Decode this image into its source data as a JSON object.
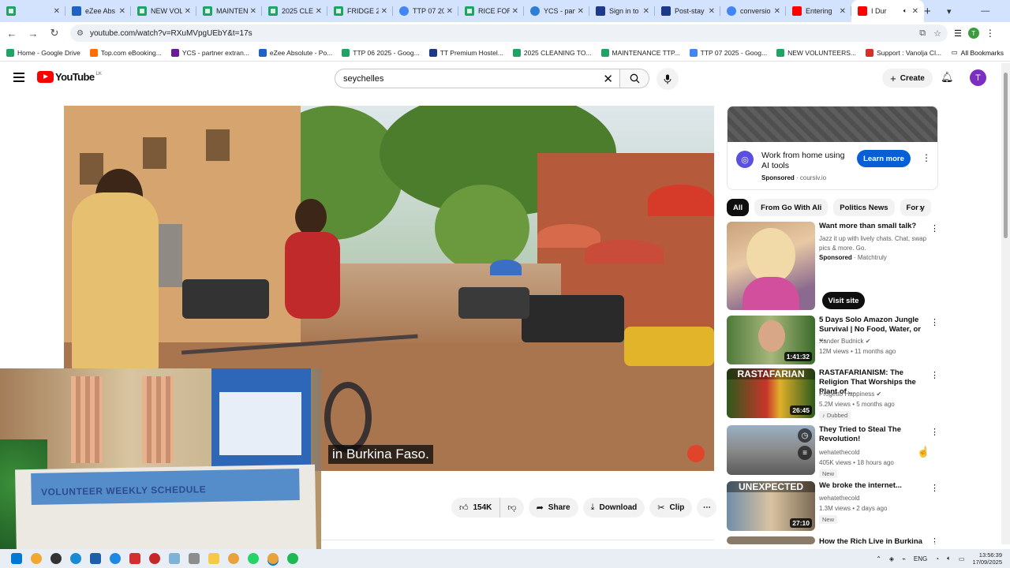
{
  "browser": {
    "tabs": [
      {
        "label": "",
        "icon": "sheet"
      },
      {
        "label": "eZee Abs",
        "icon": "ezee"
      },
      {
        "label": "NEW VOL",
        "icon": "sheet"
      },
      {
        "label": "MAINTEN",
        "icon": "sheet"
      },
      {
        "label": "2025 CLE",
        "icon": "sheet"
      },
      {
        "label": "FRIDGE 2",
        "icon": "sheet"
      },
      {
        "label": "TTP 07 20",
        "icon": "google"
      },
      {
        "label": "RICE FOR",
        "icon": "sheet"
      },
      {
        "label": "YCS - part",
        "icon": "ycs"
      },
      {
        "label": "Sign in to",
        "icon": "bold-b"
      },
      {
        "label": "Post-stay",
        "icon": "bold-b"
      },
      {
        "label": "conversio",
        "icon": "google"
      },
      {
        "label": "Entering",
        "icon": "youtube"
      },
      {
        "label": "I Dur",
        "icon": "youtube",
        "active": true
      }
    ],
    "url": "youtube.com/watch?v=RXuMVpgUEbY&t=17s",
    "bookmarks": [
      "Home - Google Drive",
      "Top.com eBooking...",
      "YCS - partner extran...",
      "eZee Absolute - Po...",
      "TTP 06 2025 - Goog...",
      "TT Premium Hostel...",
      "2025 CLEANING TO...",
      "MAINTENANCE TTP...",
      "TTP 07 2025 - Goog...",
      "NEW VOLUNTEERS...",
      "Support : Vanolja Cl..."
    ],
    "all_bookmarks": "All Bookmarks"
  },
  "youtube": {
    "logo_text": "YouTube",
    "country_code": "LK",
    "search_value": "seychelles",
    "create_label": "Create",
    "avatar_letter": "T"
  },
  "video": {
    "subtitle": "in Burkina Faso."
  },
  "webcam": {
    "paper_text": "VOLUNTEER WEEKLY SCHEDULE"
  },
  "actions": {
    "likes": "154K",
    "share": "Share",
    "download": "Download",
    "clip": "Clip"
  },
  "ad": {
    "title": "Work from home using AI tools",
    "sponsored": "Sponsored",
    "domain": "coursiv.io",
    "cta": "Learn more"
  },
  "chips": [
    "All",
    "From Go With Ali",
    "Politics News",
    "For y"
  ],
  "related": [
    {
      "title": "Want more than small talk?",
      "desc": "Jazz it up with lively chats. Chat, swap pics & more. Go.",
      "sponsored": "Sponsored",
      "advertiser": "Matchtruly",
      "cta": "Visit site"
    },
    {
      "title": "5 Days Solo Amazon Jungle Survival | No Food, Water, or ...",
      "channel": "Xander Budnick",
      "meta": "12M views • 11 months ago",
      "duration": "1:41:32"
    },
    {
      "title": "RASTAFARIANISM: The Religion That Worships the Plant of ...",
      "channel": "Progetto Happiness",
      "meta": "5.2M views • 5 months ago",
      "duration": "26:45",
      "badge": "Dubbed",
      "thumb_text": "RASTAFARIAN"
    },
    {
      "title": "They Tried to Steal The Revolution!",
      "channel": "wehatethecold",
      "meta": "405K views • 18 hours ago",
      "badge": "New"
    },
    {
      "title": "We broke the internet...",
      "channel": "wehatethecold",
      "meta": "1.3M views • 2 days ago",
      "duration": "27:10",
      "badge": "New",
      "thumb_text": "UNEXPECTED"
    },
    {
      "title": "How the Rich Live in Burkina"
    }
  ],
  "taskbar": {
    "time": "13:56:39",
    "date": "17/09/2025",
    "lang": "ENG"
  }
}
